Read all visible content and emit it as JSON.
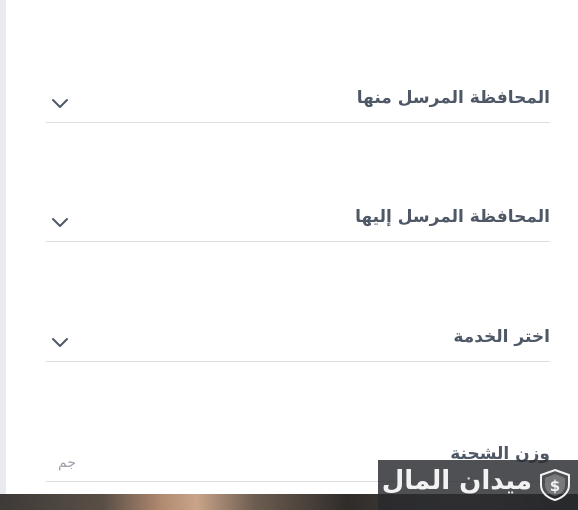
{
  "form": {
    "origin_governorate_label": "المحافظة المرسل منها",
    "destination_governorate_label": "المحافظة المرسل إليها",
    "service_label": "اختر الخدمة",
    "weight_label": "وزن الشحنة",
    "weight_unit": "جم"
  },
  "watermark": {
    "brand_text": "ميدان المال",
    "logo_icon": "shield-dollar-icon"
  },
  "icons": {
    "dropdown": "chevron-down-icon"
  },
  "colors": {
    "label": "#4e5866",
    "divider": "#dcdfe3",
    "placeholder": "#9aa1a9",
    "chevron": "#4e5866"
  }
}
